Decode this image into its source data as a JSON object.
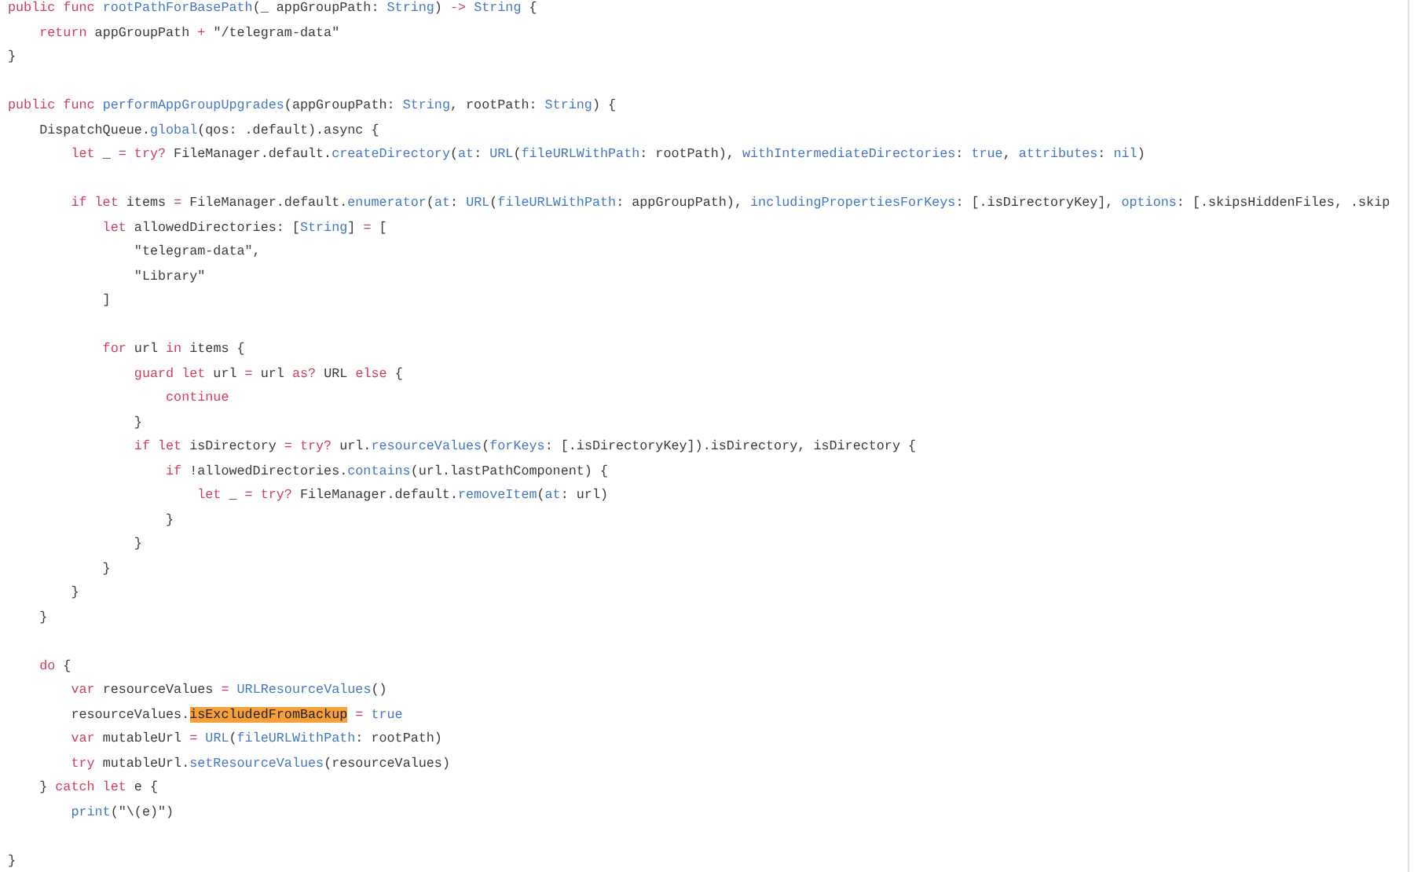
{
  "code": {
    "lines": [
      {
        "kind": "code",
        "tokens": [
          {
            "kind": "keyword",
            "text": "public func "
          },
          {
            "kind": "name",
            "text": "rootPathForBasePath"
          },
          {
            "kind": "plain",
            "text": "(_ appGroupPath: "
          },
          {
            "kind": "name",
            "text": "String"
          },
          {
            "kind": "plain",
            "text": ") "
          },
          {
            "kind": "keyword",
            "text": "-> "
          },
          {
            "kind": "name",
            "text": "String"
          },
          {
            "kind": "plain",
            "text": " {"
          }
        ]
      },
      {
        "kind": "code",
        "tokens": [
          {
            "kind": "keyword",
            "text": "    return"
          },
          {
            "kind": "plain",
            "text": " appGroupPath "
          },
          {
            "kind": "keyword",
            "text": "+"
          },
          {
            "kind": "plain",
            "text": " \"/telegram-data\""
          }
        ]
      },
      {
        "kind": "code",
        "tokens": [
          {
            "kind": "plain",
            "text": "}"
          }
        ]
      },
      {
        "kind": "blank"
      },
      {
        "kind": "code",
        "tokens": [
          {
            "kind": "keyword",
            "text": "public func "
          },
          {
            "kind": "name",
            "text": "performAppGroupUpgrades"
          },
          {
            "kind": "plain",
            "text": "(appGroupPath: "
          },
          {
            "kind": "name",
            "text": "String"
          },
          {
            "kind": "plain",
            "text": ", rootPath: "
          },
          {
            "kind": "name",
            "text": "String"
          },
          {
            "kind": "plain",
            "text": ") {"
          }
        ]
      },
      {
        "kind": "code",
        "tokens": [
          {
            "kind": "plain",
            "text": "    DispatchQueue."
          },
          {
            "kind": "name",
            "text": "global"
          },
          {
            "kind": "plain",
            "text": "(qos: .default).async {"
          }
        ]
      },
      {
        "kind": "code",
        "tokens": [
          {
            "kind": "keyword",
            "text": "        let"
          },
          {
            "kind": "plain",
            "text": " _ "
          },
          {
            "kind": "keyword",
            "text": "= try?"
          },
          {
            "kind": "plain",
            "text": " FileManager.default."
          },
          {
            "kind": "name",
            "text": "createDirectory"
          },
          {
            "kind": "plain",
            "text": "("
          },
          {
            "kind": "name",
            "text": "at"
          },
          {
            "kind": "plain",
            "text": ": "
          },
          {
            "kind": "name",
            "text": "URL"
          },
          {
            "kind": "plain",
            "text": "("
          },
          {
            "kind": "name",
            "text": "fileURLWithPath"
          },
          {
            "kind": "plain",
            "text": ": rootPath), "
          },
          {
            "kind": "name",
            "text": "withIntermediateDirectories"
          },
          {
            "kind": "plain",
            "text": ": "
          },
          {
            "kind": "name",
            "text": "true"
          },
          {
            "kind": "plain",
            "text": ", "
          },
          {
            "kind": "name",
            "text": "attributes"
          },
          {
            "kind": "plain",
            "text": ": "
          },
          {
            "kind": "name",
            "text": "nil"
          },
          {
            "kind": "plain",
            "text": ")"
          }
        ]
      },
      {
        "kind": "blank"
      },
      {
        "kind": "code",
        "tokens": [
          {
            "kind": "keyword",
            "text": "        if let"
          },
          {
            "kind": "plain",
            "text": " items "
          },
          {
            "kind": "keyword",
            "text": "="
          },
          {
            "kind": "plain",
            "text": " FileManager.default."
          },
          {
            "kind": "name",
            "text": "enumerator"
          },
          {
            "kind": "plain",
            "text": "("
          },
          {
            "kind": "name",
            "text": "at"
          },
          {
            "kind": "plain",
            "text": ": "
          },
          {
            "kind": "name",
            "text": "URL"
          },
          {
            "kind": "plain",
            "text": "("
          },
          {
            "kind": "name",
            "text": "fileURLWithPath"
          },
          {
            "kind": "plain",
            "text": ": appGroupPath), "
          },
          {
            "kind": "name",
            "text": "includingPropertiesForKeys"
          },
          {
            "kind": "plain",
            "text": ": [.isDirectoryKey], "
          },
          {
            "kind": "name",
            "text": "options"
          },
          {
            "kind": "plain",
            "text": ": [.skipsHiddenFiles, .skip"
          }
        ]
      },
      {
        "kind": "code",
        "tokens": [
          {
            "kind": "keyword",
            "text": "            let"
          },
          {
            "kind": "plain",
            "text": " allowedDirectories: ["
          },
          {
            "kind": "name",
            "text": "String"
          },
          {
            "kind": "plain",
            "text": "] "
          },
          {
            "kind": "keyword",
            "text": "="
          },
          {
            "kind": "plain",
            "text": " ["
          }
        ]
      },
      {
        "kind": "code",
        "tokens": [
          {
            "kind": "plain",
            "text": "                \"telegram-data\","
          }
        ]
      },
      {
        "kind": "code",
        "tokens": [
          {
            "kind": "plain",
            "text": "                \"Library\""
          }
        ]
      },
      {
        "kind": "code",
        "tokens": [
          {
            "kind": "plain",
            "text": "            ]"
          }
        ]
      },
      {
        "kind": "blank"
      },
      {
        "kind": "code",
        "tokens": [
          {
            "kind": "keyword",
            "text": "            for"
          },
          {
            "kind": "plain",
            "text": " url "
          },
          {
            "kind": "keyword",
            "text": "in"
          },
          {
            "kind": "plain",
            "text": " items {"
          }
        ]
      },
      {
        "kind": "code",
        "tokens": [
          {
            "kind": "keyword",
            "text": "                guard let"
          },
          {
            "kind": "plain",
            "text": " url "
          },
          {
            "kind": "keyword",
            "text": "="
          },
          {
            "kind": "plain",
            "text": " url "
          },
          {
            "kind": "keyword",
            "text": "as?"
          },
          {
            "kind": "plain",
            "text": " URL "
          },
          {
            "kind": "keyword",
            "text": "else"
          },
          {
            "kind": "plain",
            "text": " {"
          }
        ]
      },
      {
        "kind": "code",
        "tokens": [
          {
            "kind": "keyword",
            "text": "                    continue"
          }
        ]
      },
      {
        "kind": "code",
        "tokens": [
          {
            "kind": "plain",
            "text": "                }"
          }
        ]
      },
      {
        "kind": "code",
        "tokens": [
          {
            "kind": "keyword",
            "text": "                if let"
          },
          {
            "kind": "plain",
            "text": " isDirectory "
          },
          {
            "kind": "keyword",
            "text": "= try?"
          },
          {
            "kind": "plain",
            "text": " url."
          },
          {
            "kind": "name",
            "text": "resourceValues"
          },
          {
            "kind": "plain",
            "text": "("
          },
          {
            "kind": "name",
            "text": "forKeys"
          },
          {
            "kind": "plain",
            "text": ": [.isDirectoryKey]).isDirectory, isDirectory {"
          }
        ]
      },
      {
        "kind": "code",
        "tokens": [
          {
            "kind": "keyword",
            "text": "                    if"
          },
          {
            "kind": "plain",
            "text": " !allowedDirectories."
          },
          {
            "kind": "name",
            "text": "contains"
          },
          {
            "kind": "plain",
            "text": "(url.lastPathComponent) {"
          }
        ]
      },
      {
        "kind": "code",
        "tokens": [
          {
            "kind": "keyword",
            "text": "                        let"
          },
          {
            "kind": "plain",
            "text": " _ "
          },
          {
            "kind": "keyword",
            "text": "= try?"
          },
          {
            "kind": "plain",
            "text": " FileManager.default."
          },
          {
            "kind": "name",
            "text": "removeItem"
          },
          {
            "kind": "plain",
            "text": "("
          },
          {
            "kind": "name",
            "text": "at"
          },
          {
            "kind": "plain",
            "text": ": url)"
          }
        ]
      },
      {
        "kind": "code",
        "tokens": [
          {
            "kind": "plain",
            "text": "                    }"
          }
        ]
      },
      {
        "kind": "code",
        "tokens": [
          {
            "kind": "plain",
            "text": "                }"
          }
        ]
      },
      {
        "kind": "code",
        "tokens": [
          {
            "kind": "plain",
            "text": "            }"
          }
        ]
      },
      {
        "kind": "code",
        "tokens": [
          {
            "kind": "plain",
            "text": "        }"
          }
        ]
      },
      {
        "kind": "code",
        "tokens": [
          {
            "kind": "plain",
            "text": "    }"
          }
        ]
      },
      {
        "kind": "blank"
      },
      {
        "kind": "code",
        "tokens": [
          {
            "kind": "keyword",
            "text": "    do"
          },
          {
            "kind": "plain",
            "text": " {"
          }
        ]
      },
      {
        "kind": "code",
        "tokens": [
          {
            "kind": "keyword",
            "text": "        var"
          },
          {
            "kind": "plain",
            "text": " resourceValues "
          },
          {
            "kind": "keyword",
            "text": "= "
          },
          {
            "kind": "name",
            "text": "URLResourceValues"
          },
          {
            "kind": "plain",
            "text": "()"
          }
        ]
      },
      {
        "kind": "code",
        "tokens": [
          {
            "kind": "plain",
            "text": "        resourceValues."
          },
          {
            "kind": "highlight",
            "text": "isExcludedFromBackup"
          },
          {
            "kind": "keyword",
            "text": " = "
          },
          {
            "kind": "name",
            "text": "true"
          }
        ]
      },
      {
        "kind": "code",
        "tokens": [
          {
            "kind": "keyword",
            "text": "        var"
          },
          {
            "kind": "plain",
            "text": " mutableUrl "
          },
          {
            "kind": "keyword",
            "text": "= "
          },
          {
            "kind": "name",
            "text": "URL"
          },
          {
            "kind": "plain",
            "text": "("
          },
          {
            "kind": "name",
            "text": "fileURLWithPath"
          },
          {
            "kind": "plain",
            "text": ": rootPath)"
          }
        ]
      },
      {
        "kind": "code",
        "tokens": [
          {
            "kind": "keyword",
            "text": "        try"
          },
          {
            "kind": "plain",
            "text": " mutableUrl."
          },
          {
            "kind": "name",
            "text": "setResourceValues"
          },
          {
            "kind": "plain",
            "text": "(resourceValues)"
          }
        ]
      },
      {
        "kind": "code",
        "tokens": [
          {
            "kind": "plain",
            "text": "    } "
          },
          {
            "kind": "keyword",
            "text": "catch let"
          },
          {
            "kind": "plain",
            "text": " e {"
          }
        ]
      },
      {
        "kind": "code",
        "tokens": [
          {
            "kind": "name",
            "text": "        print"
          },
          {
            "kind": "plain",
            "text": "(\"\\(e)\")"
          }
        ]
      },
      {
        "kind": "blank"
      },
      {
        "kind": "code",
        "tokens": [
          {
            "kind": "plain",
            "text": "}"
          }
        ]
      }
    ]
  }
}
